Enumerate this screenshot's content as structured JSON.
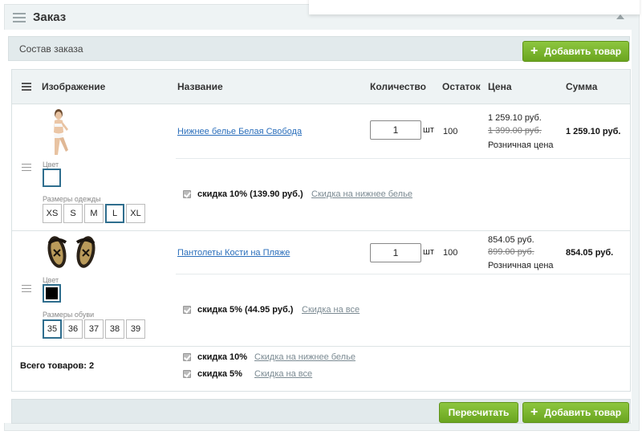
{
  "header": {
    "title": "Заказ"
  },
  "section": {
    "title": "Состав заказа",
    "add_button": "Добавить товар"
  },
  "table": {
    "columns": [
      "Изображение",
      "Название",
      "Количество",
      "Остаток",
      "Цена",
      "Сумма"
    ]
  },
  "items": [
    {
      "name": "Нижнее белье Белая Свобода",
      "quantity": "1",
      "unit": "шт",
      "stock": "100",
      "price": "1 259.10 руб.",
      "old_price": "1 399.00 руб.",
      "price_type": "Розничная цена",
      "sum": "1 259.10 руб.",
      "color_label": "Цвет",
      "sizes_label": "Размеры одежды",
      "sizes": [
        "XS",
        "S",
        "M",
        "L",
        "XL"
      ],
      "selected_size": "L",
      "discount_text": "скидка 10% (139.90 руб.)",
      "discount_link": "Скидка на нижнее белье"
    },
    {
      "name": "Пантолеты Кости на Пляже",
      "quantity": "1",
      "unit": "шт",
      "stock": "100",
      "price": "854.05 руб.",
      "old_price": "899.00 руб.",
      "price_type": "Розничная цена",
      "sum": "854.05 руб.",
      "color_label": "Цвет",
      "sizes_label": "Размеры обуви",
      "sizes": [
        "35",
        "36",
        "37",
        "38",
        "39"
      ],
      "selected_size": "35",
      "discount_text": "скидка 5% (44.95 руб.)",
      "discount_link": "Скидка на все"
    }
  ],
  "summary": {
    "total_label": "Всего товаров: 2",
    "discounts": [
      {
        "text": "скидка 10%",
        "link": "Скидка на нижнее белье"
      },
      {
        "text": "скидка 5%",
        "link": "Скидка на все"
      }
    ]
  },
  "footer": {
    "recalc_button": "Пересчитать",
    "add_button": "Добавить товар"
  },
  "colors": {
    "accent_green": "#7ab52f",
    "selected_border": "#2f6e8e",
    "link": "#2a6ebb"
  }
}
